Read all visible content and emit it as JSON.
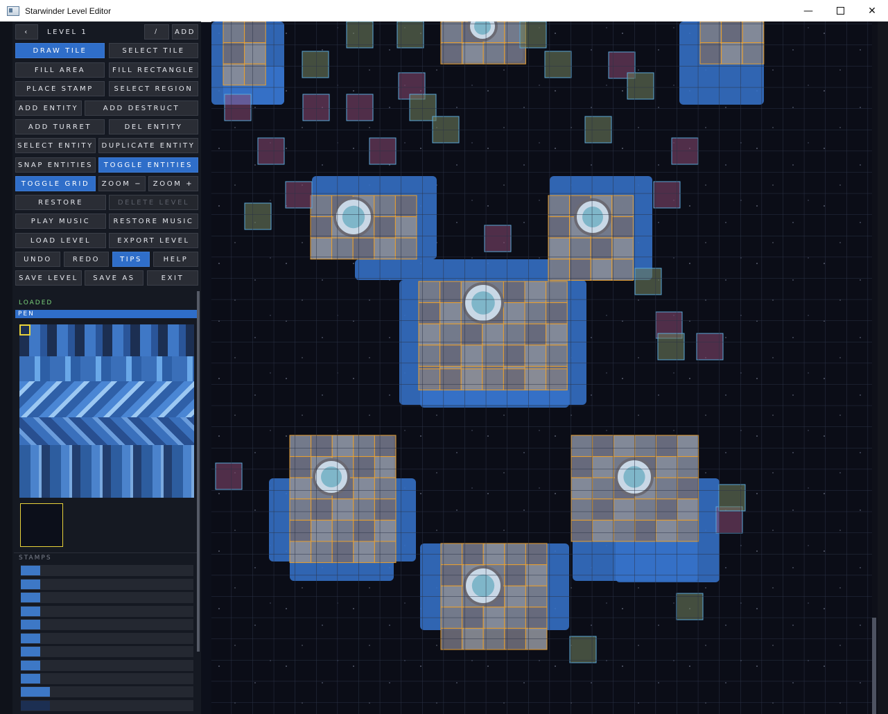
{
  "window": {
    "title": "Starwinder Level Editor",
    "controls": [
      "minimize-icon",
      "maximize-icon",
      "close-icon"
    ]
  },
  "toolbar": {
    "level_prev_icon": "chevron-left-icon",
    "level_label": "LEVEL 1",
    "rename_icon": "pencil-icon",
    "add_label": "ADD",
    "buttons": {
      "draw_tile": "DRAW TILE",
      "select_tile": "SELECT TILE",
      "fill_area": "FILL AREA",
      "fill_rectangle": "FILL RECTANGLE",
      "place_stamp": "PLACE STAMP",
      "select_region": "SELECT REGION",
      "add_entity": "ADD ENTITY",
      "add_destruct": "ADD DESTRUCT",
      "add_turret": "ADD TURRET",
      "del_entity": "DEL ENTITY",
      "select_entity": "SELECT ENTITY",
      "duplicate_entity": "DUPLICATE ENTITY",
      "snap_entities": "SNAP ENTITIES",
      "toggle_entities": "TOGGLE ENTITIES",
      "toggle_grid": "TOGGLE GRID",
      "zoom_out": "ZOOM −",
      "zoom_in": "ZOOM +",
      "restore": "RESTORE",
      "delete_level": "DELETE LEVEL",
      "play_music": "PLAY MUSIC",
      "restore_music": "RESTORE MUSIC",
      "load_level": "LOAD LEVEL",
      "export_level": "EXPORT LEVEL",
      "undo": "UNDO",
      "redo": "REDO",
      "tips": "TIPS",
      "help": "HELP",
      "save_level": "SAVE LEVEL",
      "save_as": "SAVE AS",
      "exit": "EXIT"
    },
    "active_buttons": [
      "draw_tile",
      "toggle_entities",
      "toggle_grid",
      "tips"
    ],
    "disabled_buttons": [
      "delete_level"
    ]
  },
  "panel": {
    "status": "LOADED",
    "tool": "PEN",
    "stamps_label": "STAMPS",
    "stamp_count": 11
  },
  "colors": {
    "accent": "#2f6ec9",
    "status_ok": "#79d17a",
    "selection": "#e8d23a",
    "tile_outline": "#e8a030",
    "entity_outline": "#5aa8d8",
    "floor_blue": "#3a7ad0",
    "map_background": "#0b0d17"
  }
}
